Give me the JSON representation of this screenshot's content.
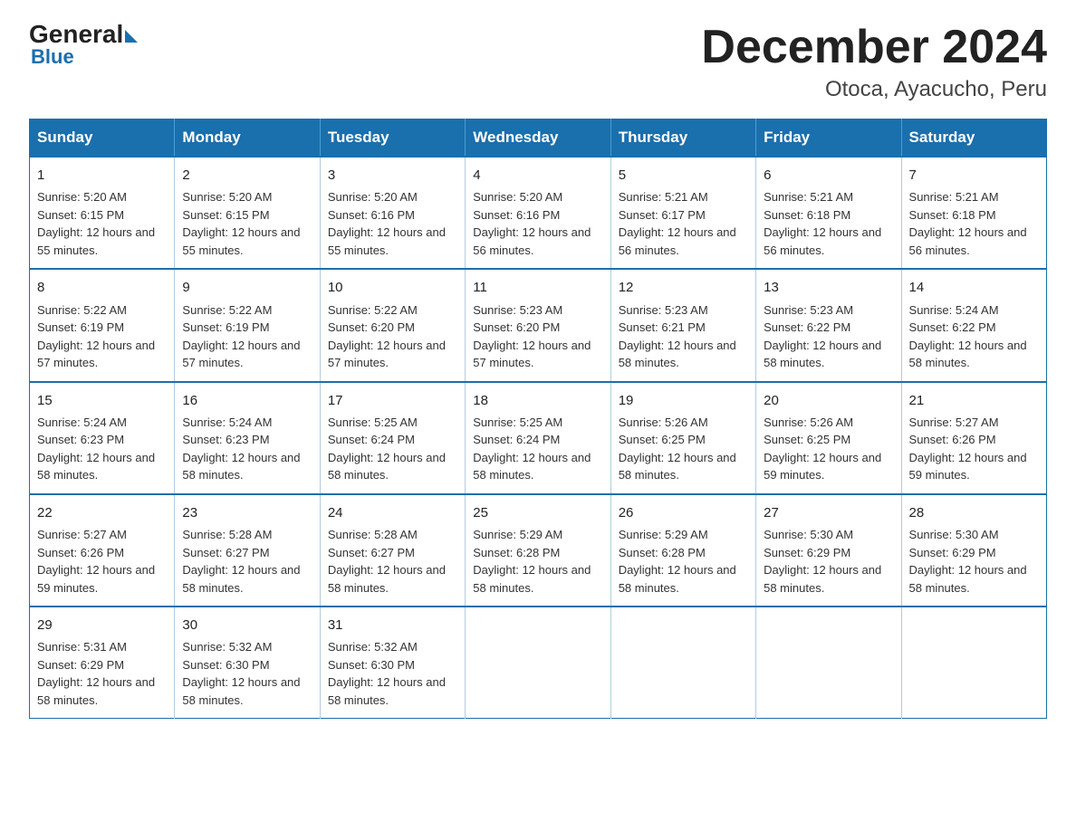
{
  "header": {
    "logo_general": "General",
    "logo_blue": "Blue",
    "title": "December 2024",
    "subtitle": "Otoca, Ayacucho, Peru"
  },
  "calendar": {
    "days_of_week": [
      "Sunday",
      "Monday",
      "Tuesday",
      "Wednesday",
      "Thursday",
      "Friday",
      "Saturday"
    ],
    "weeks": [
      [
        {
          "day": "1",
          "sunrise": "5:20 AM",
          "sunset": "6:15 PM",
          "daylight": "12 hours and 55 minutes."
        },
        {
          "day": "2",
          "sunrise": "5:20 AM",
          "sunset": "6:15 PM",
          "daylight": "12 hours and 55 minutes."
        },
        {
          "day": "3",
          "sunrise": "5:20 AM",
          "sunset": "6:16 PM",
          "daylight": "12 hours and 55 minutes."
        },
        {
          "day": "4",
          "sunrise": "5:20 AM",
          "sunset": "6:16 PM",
          "daylight": "12 hours and 56 minutes."
        },
        {
          "day": "5",
          "sunrise": "5:21 AM",
          "sunset": "6:17 PM",
          "daylight": "12 hours and 56 minutes."
        },
        {
          "day": "6",
          "sunrise": "5:21 AM",
          "sunset": "6:18 PM",
          "daylight": "12 hours and 56 minutes."
        },
        {
          "day": "7",
          "sunrise": "5:21 AM",
          "sunset": "6:18 PM",
          "daylight": "12 hours and 56 minutes."
        }
      ],
      [
        {
          "day": "8",
          "sunrise": "5:22 AM",
          "sunset": "6:19 PM",
          "daylight": "12 hours and 57 minutes."
        },
        {
          "day": "9",
          "sunrise": "5:22 AM",
          "sunset": "6:19 PM",
          "daylight": "12 hours and 57 minutes."
        },
        {
          "day": "10",
          "sunrise": "5:22 AM",
          "sunset": "6:20 PM",
          "daylight": "12 hours and 57 minutes."
        },
        {
          "day": "11",
          "sunrise": "5:23 AM",
          "sunset": "6:20 PM",
          "daylight": "12 hours and 57 minutes."
        },
        {
          "day": "12",
          "sunrise": "5:23 AM",
          "sunset": "6:21 PM",
          "daylight": "12 hours and 58 minutes."
        },
        {
          "day": "13",
          "sunrise": "5:23 AM",
          "sunset": "6:22 PM",
          "daylight": "12 hours and 58 minutes."
        },
        {
          "day": "14",
          "sunrise": "5:24 AM",
          "sunset": "6:22 PM",
          "daylight": "12 hours and 58 minutes."
        }
      ],
      [
        {
          "day": "15",
          "sunrise": "5:24 AM",
          "sunset": "6:23 PM",
          "daylight": "12 hours and 58 minutes."
        },
        {
          "day": "16",
          "sunrise": "5:24 AM",
          "sunset": "6:23 PM",
          "daylight": "12 hours and 58 minutes."
        },
        {
          "day": "17",
          "sunrise": "5:25 AM",
          "sunset": "6:24 PM",
          "daylight": "12 hours and 58 minutes."
        },
        {
          "day": "18",
          "sunrise": "5:25 AM",
          "sunset": "6:24 PM",
          "daylight": "12 hours and 58 minutes."
        },
        {
          "day": "19",
          "sunrise": "5:26 AM",
          "sunset": "6:25 PM",
          "daylight": "12 hours and 58 minutes."
        },
        {
          "day": "20",
          "sunrise": "5:26 AM",
          "sunset": "6:25 PM",
          "daylight": "12 hours and 59 minutes."
        },
        {
          "day": "21",
          "sunrise": "5:27 AM",
          "sunset": "6:26 PM",
          "daylight": "12 hours and 59 minutes."
        }
      ],
      [
        {
          "day": "22",
          "sunrise": "5:27 AM",
          "sunset": "6:26 PM",
          "daylight": "12 hours and 59 minutes."
        },
        {
          "day": "23",
          "sunrise": "5:28 AM",
          "sunset": "6:27 PM",
          "daylight": "12 hours and 58 minutes."
        },
        {
          "day": "24",
          "sunrise": "5:28 AM",
          "sunset": "6:27 PM",
          "daylight": "12 hours and 58 minutes."
        },
        {
          "day": "25",
          "sunrise": "5:29 AM",
          "sunset": "6:28 PM",
          "daylight": "12 hours and 58 minutes."
        },
        {
          "day": "26",
          "sunrise": "5:29 AM",
          "sunset": "6:28 PM",
          "daylight": "12 hours and 58 minutes."
        },
        {
          "day": "27",
          "sunrise": "5:30 AM",
          "sunset": "6:29 PM",
          "daylight": "12 hours and 58 minutes."
        },
        {
          "day": "28",
          "sunrise": "5:30 AM",
          "sunset": "6:29 PM",
          "daylight": "12 hours and 58 minutes."
        }
      ],
      [
        {
          "day": "29",
          "sunrise": "5:31 AM",
          "sunset": "6:29 PM",
          "daylight": "12 hours and 58 minutes."
        },
        {
          "day": "30",
          "sunrise": "5:32 AM",
          "sunset": "6:30 PM",
          "daylight": "12 hours and 58 minutes."
        },
        {
          "day": "31",
          "sunrise": "5:32 AM",
          "sunset": "6:30 PM",
          "daylight": "12 hours and 58 minutes."
        },
        null,
        null,
        null,
        null
      ]
    ]
  }
}
